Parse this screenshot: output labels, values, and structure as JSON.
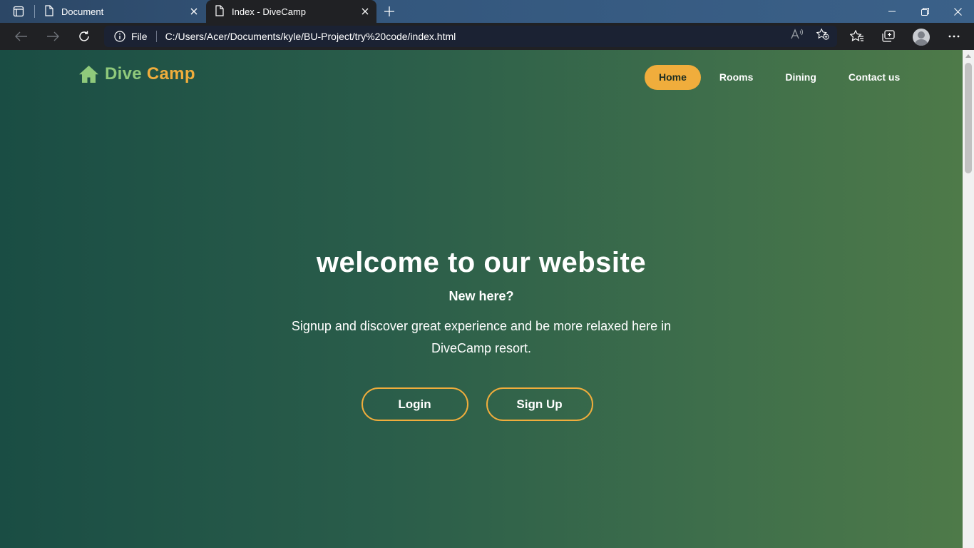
{
  "browser": {
    "tabs": [
      {
        "title": "Document",
        "active": false
      },
      {
        "title": "Index - DiveCamp",
        "active": true
      }
    ],
    "address": {
      "scheme_label": "File",
      "url": "C:/Users/Acer/Documents/kyle/BU-Project/try%20code/index.html"
    },
    "icons": [
      "tab-actions-icon",
      "doc-icon",
      "close-icon",
      "new-tab-icon",
      "minimize-icon",
      "restore-icon",
      "window-close-icon",
      "back-icon",
      "forward-icon",
      "refresh-icon",
      "info-icon",
      "read-aloud-icon",
      "add-favorite-icon",
      "favorites-icon",
      "collections-icon",
      "profile-avatar",
      "more-icon"
    ]
  },
  "site": {
    "logo": {
      "word1": "Dive",
      "word2": "Camp"
    },
    "nav": [
      {
        "label": "Home",
        "active": true
      },
      {
        "label": "Rooms",
        "active": false
      },
      {
        "label": "Dining",
        "active": false
      },
      {
        "label": "Contact us",
        "active": false
      }
    ],
    "hero": {
      "title": "welcome to our website",
      "subtitle": "New here?",
      "description": "Signup and discover great experience and be more relaxed here in DiveCamp resort.",
      "login_label": "Login",
      "signup_label": "Sign Up"
    }
  },
  "colors": {
    "accent": "#f0ad3c",
    "logo_green": "#8fc97b",
    "bg_left": "#1a4d44",
    "bg_right": "#4e7a49"
  }
}
